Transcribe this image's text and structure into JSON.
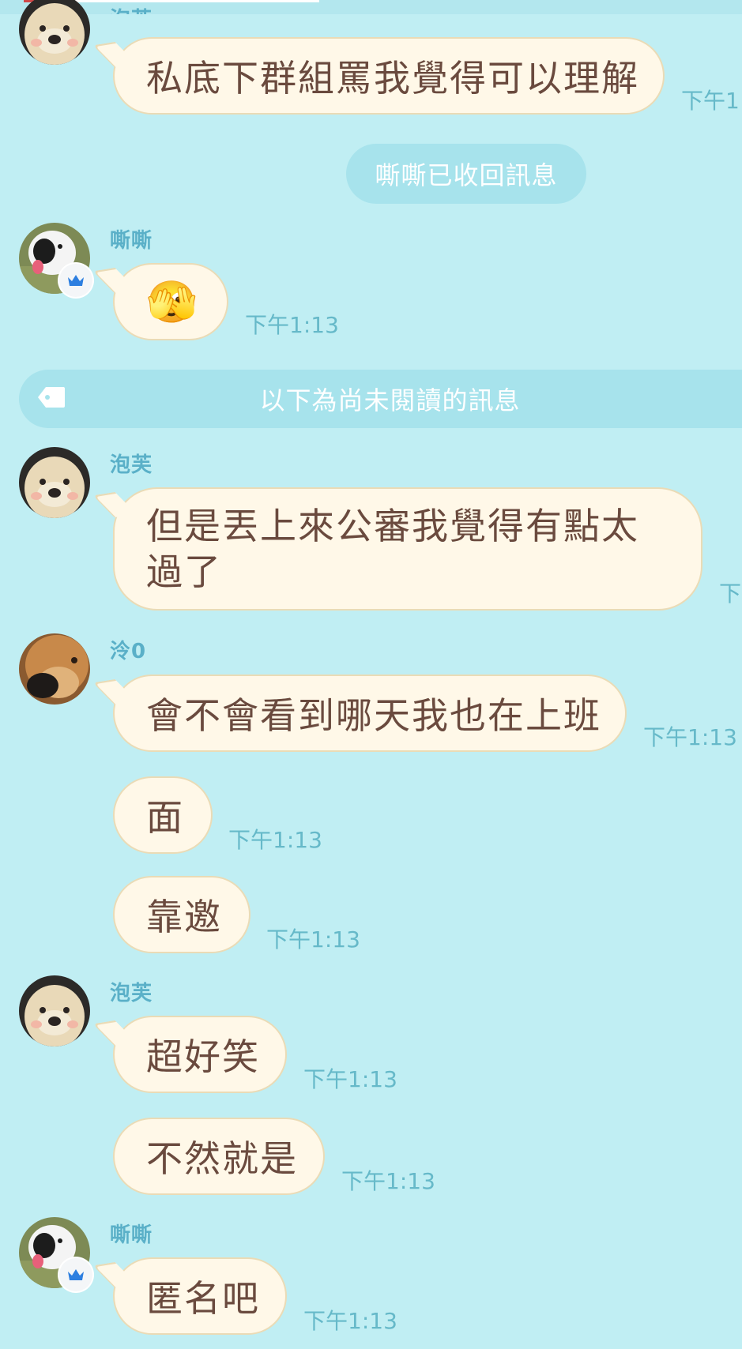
{
  "messages": {
    "m1": {
      "sender": "泡芙",
      "text": "私底下群組罵我覺得可以理解",
      "time": "下午1"
    },
    "recall_notice": "嘶嘶已收回訊息",
    "m2": {
      "sender": "嘶嘶",
      "emoji": "🫣",
      "time": "下午1:13"
    },
    "unread_divider": "以下為尚未閱讀的訊息",
    "m3": {
      "sender": "泡芙",
      "text": "但是丟上來公審我覺得有點太過了",
      "time": "下"
    },
    "m4": {
      "sender": "泠0",
      "text": "會不會看到哪天我也在上班",
      "time": "下午1:13"
    },
    "m5": {
      "text": "面",
      "time": "下午1:13"
    },
    "m6": {
      "text": "靠邀",
      "time": "下午1:13"
    },
    "m7": {
      "sender": "泡芙",
      "text": "超好笑",
      "time": "下午1:13"
    },
    "m8": {
      "text": "不然就是",
      "time": "下午1:13"
    },
    "m9": {
      "sender": "嘶嘶",
      "text": "匿名吧",
      "time": "下午1:13"
    }
  },
  "icons": {
    "crown": "crown-icon",
    "tag": "tag-icon"
  },
  "colors": {
    "background": "#c0eef3",
    "bubble": "#fff8e8",
    "bubble_border": "#eadbb6",
    "text": "#6a4a3e",
    "sender": "#5ab0c8",
    "time": "#66b9c9",
    "notice": "#a7e3ec",
    "crown": "#2d7fe0"
  }
}
